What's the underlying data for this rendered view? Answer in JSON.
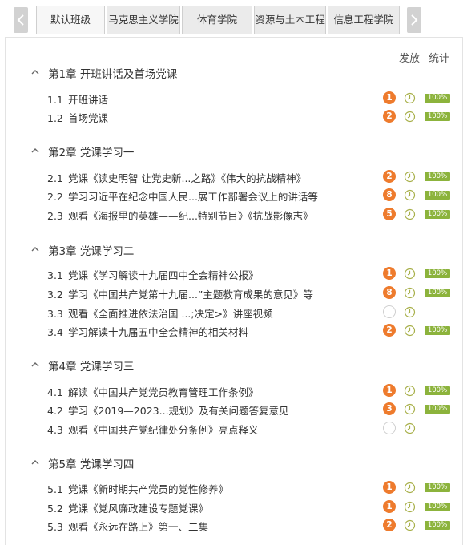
{
  "tabs": [
    "默认班级",
    "马克思主义学院",
    "体育学院",
    "资源与土木工程",
    "信息工程学院"
  ],
  "columns": {
    "publish": "发放",
    "stats": "统计"
  },
  "chapters": [
    {
      "title": "第1章  开班讲话及首场党课",
      "lessons": [
        {
          "num": "1.1",
          "title": "开班讲话",
          "badge": "1",
          "progress": "100%"
        },
        {
          "num": "1.2",
          "title": "首场党课",
          "badge": "2",
          "progress": "100%"
        }
      ]
    },
    {
      "title": "第2章  党课学习一",
      "lessons": [
        {
          "num": "2.1",
          "title": "党课《读史明智 让党史新...之路》《伟大的抗战精神》",
          "badge": "2",
          "progress": "100%"
        },
        {
          "num": "2.2",
          "title": "学习习近平在纪念中国人民...展工作部署会议上的讲话等",
          "badge": "8",
          "progress": "100%"
        },
        {
          "num": "2.3",
          "title": "观看《海报里的英雄——纪...特别节目》《抗战影像志》",
          "badge": "5",
          "progress": "100%"
        }
      ]
    },
    {
      "title": "第3章  党课学习二",
      "lessons": [
        {
          "num": "3.1",
          "title": "党课《学习解读十九届四中全会精神公报》",
          "badge": "1",
          "progress": "100%"
        },
        {
          "num": "3.2",
          "title": "学习《中国共产党第十九届...”主题教育成果的意见》等",
          "badge": "8",
          "progress": "100%"
        },
        {
          "num": "3.3",
          "title": "观看《全面推进依法治国 ...;决定>》讲座视频",
          "badge": "",
          "progress": ""
        },
        {
          "num": "3.4",
          "title": "学习解读十九届五中全会精神的相关材料",
          "badge": "2",
          "progress": "100%"
        }
      ]
    },
    {
      "title": "第4章  党课学习三",
      "lessons": [
        {
          "num": "4.1",
          "title": "解读《中国共产党党员教育管理工作条例》",
          "badge": "1",
          "progress": "100%"
        },
        {
          "num": "4.2",
          "title": "学习《2019—2023...规划》及有关问题答复意见",
          "badge": "3",
          "progress": "100%"
        },
        {
          "num": "4.3",
          "title": "观看《中国共产党纪律处分条例》亮点释义",
          "badge": "",
          "progress": ""
        }
      ]
    },
    {
      "title": "第5章  党课学习四",
      "lessons": [
        {
          "num": "5.1",
          "title": "党课《新时期共产党员的党性修养》",
          "badge": "1",
          "progress": "100%"
        },
        {
          "num": "5.2",
          "title": "党课《党风廉政建设专题党课》",
          "badge": "1",
          "progress": "100%"
        },
        {
          "num": "5.3",
          "title": "观看《永远在路上》第一、二集",
          "badge": "2",
          "progress": "100%"
        }
      ]
    }
  ],
  "colors": {
    "badge": "#ee7b2d",
    "progress": "#8cb33c",
    "clock": "#a8b04a"
  }
}
